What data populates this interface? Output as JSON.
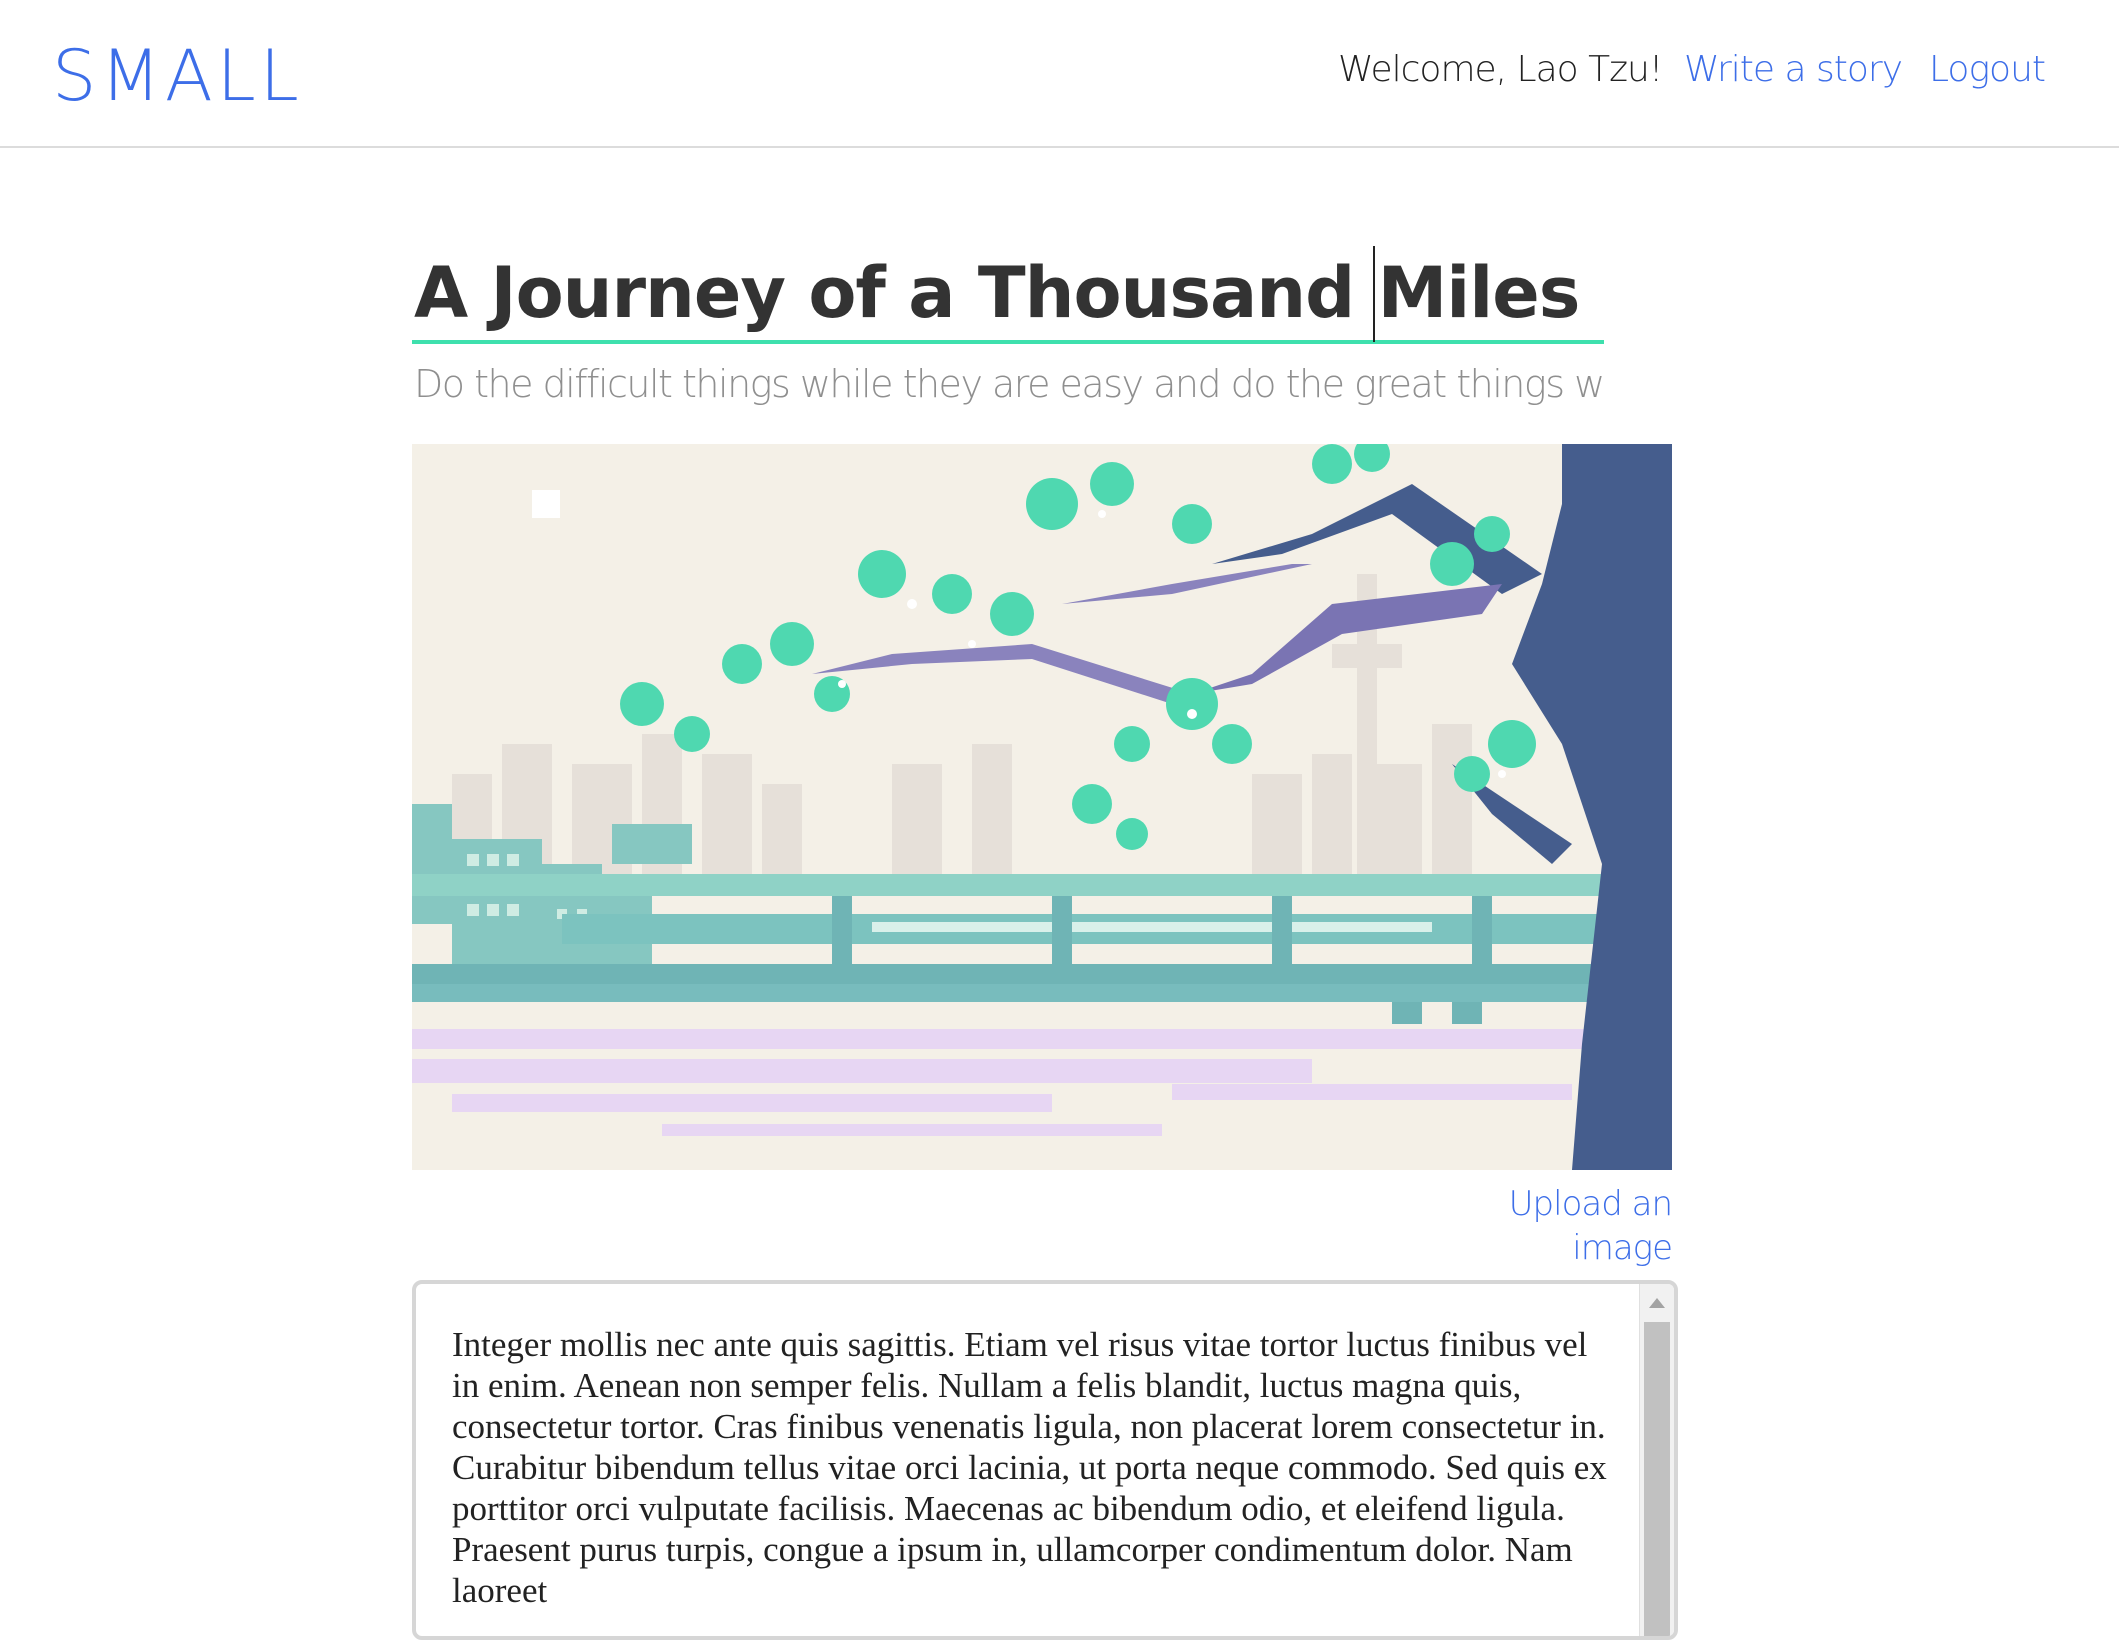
{
  "header": {
    "logo": "SMALL",
    "welcome": "Welcome, Lao Tzu!",
    "write_story": "Write a story",
    "logout": "Logout"
  },
  "editor": {
    "title": "A Journey of a Thousand Miles",
    "subtitle": "Do the difficult things while they are easy and do the great things while they are small",
    "upload_label": "Upload an image",
    "body": "Integer mollis nec ante quis sagittis. Etiam vel risus vitae tortor luctus finibus vel in enim. Aenean non semper felis. Nullam a felis blandit, luctus magna quis, consectetur tortor. Cras finibus venenatis ligula, non placerat lorem consectetur in. Curabitur bibendum tellus vitae orci lacinia, ut porta neque commodo. Sed quis ex porttitor orci vulputate facilisis. Maecenas ac bibendum odio, et eleifend ligula. Praesent purus turpis, congue a ipsum in, ullamcorper condimentum dolor. Nam laoreet"
  },
  "colors": {
    "brand": "#3d6ee8",
    "title_underline": "#3ee0ad",
    "sky": "#f4f0e7",
    "tree": "#455d8d",
    "leaves": "#4fd8b0",
    "water": "#e7d6f3",
    "bridge": "#7cc3bf"
  },
  "icons": {
    "cover_image": "pixel-art-city-river-tree-illustration",
    "scroll_up": "triangle-up-icon"
  }
}
